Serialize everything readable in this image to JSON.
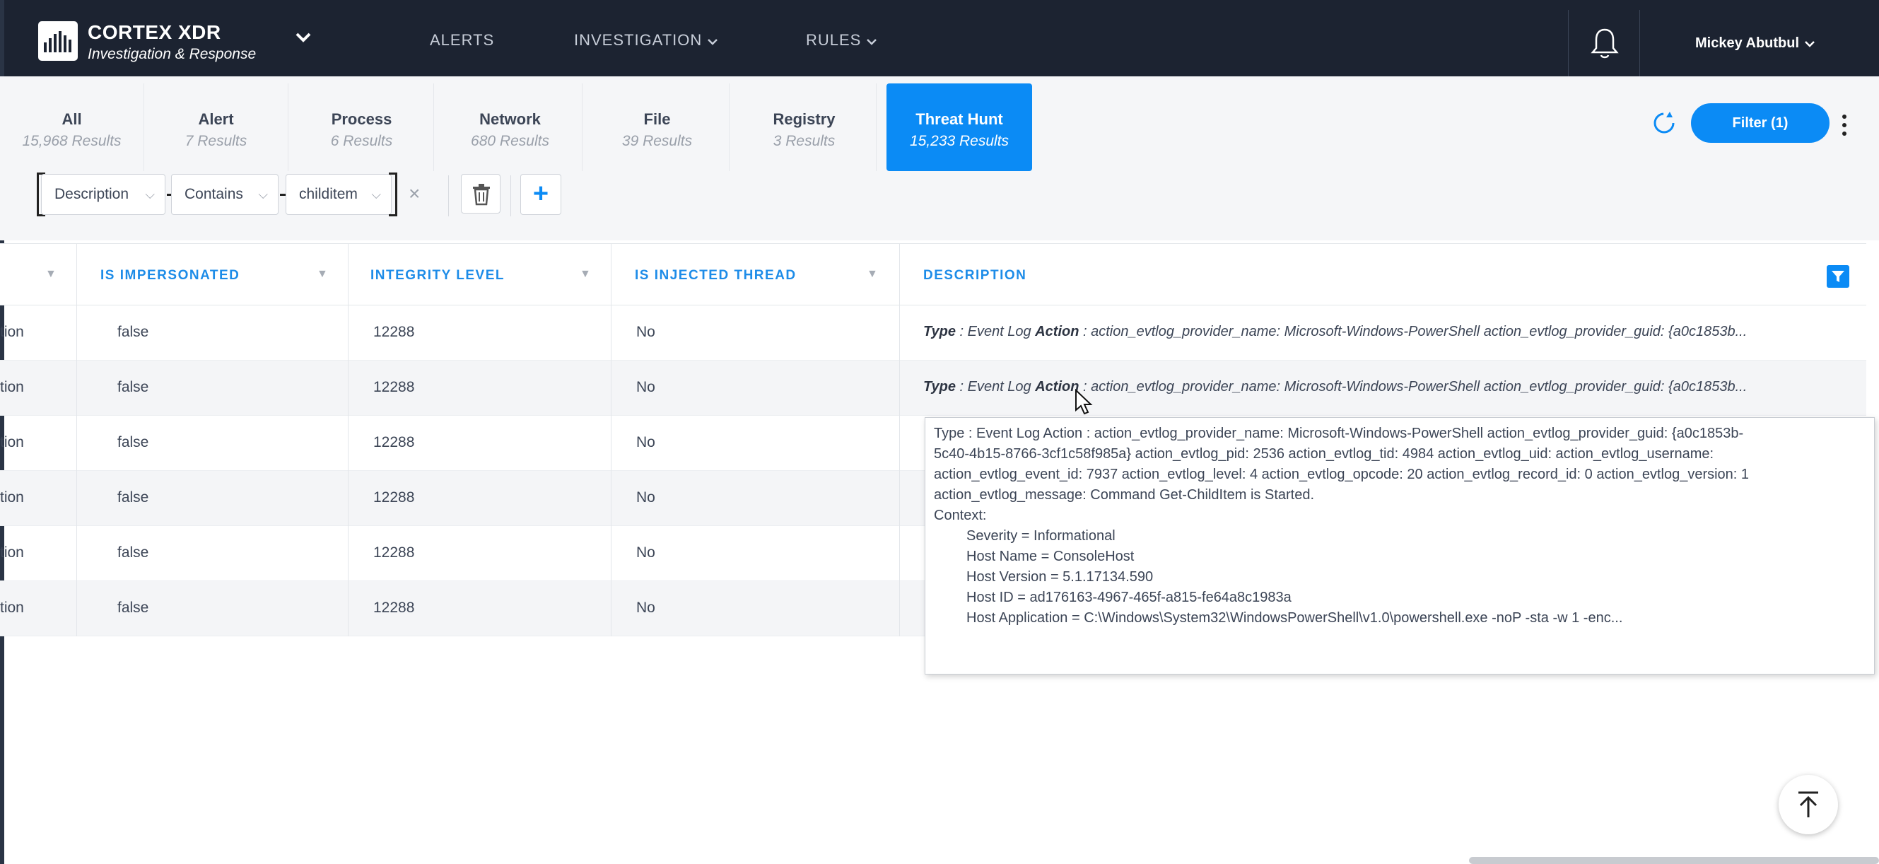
{
  "header": {
    "brand_title": "CORTEX XDR",
    "brand_subtitle": "Investigation & Response",
    "nav": [
      {
        "label": "ALERTS"
      },
      {
        "label": "INVESTIGATION"
      },
      {
        "label": "RULES"
      }
    ],
    "user_name": "Mickey Abutbul"
  },
  "tabs": [
    {
      "label": "All",
      "count": "15,968 Results"
    },
    {
      "label": "Alert",
      "count": "7 Results"
    },
    {
      "label": "Process",
      "count": "6 Results"
    },
    {
      "label": "Network",
      "count": "680 Results"
    },
    {
      "label": "File",
      "count": "39 Results"
    },
    {
      "label": "Registry",
      "count": "3 Results"
    },
    {
      "label": "Threat Hunt",
      "count": "15,233 Results",
      "active": true
    }
  ],
  "toolbar": {
    "filter_label": "Filter (1)"
  },
  "filter": {
    "field": "Description",
    "operator": "Contains",
    "value": "childitem"
  },
  "table": {
    "columns": [
      "IS IMPERSONATED",
      "INTEGRITY LEVEL",
      "IS INJECTED THREAD",
      "DESCRIPTION"
    ],
    "rows": [
      {
        "prev": "tion",
        "impersonated": "false",
        "integrity": "12288",
        "injected": "No"
      },
      {
        "prev": "tion",
        "impersonated": "false",
        "integrity": "12288",
        "injected": "No"
      },
      {
        "prev": "tion",
        "impersonated": "false",
        "integrity": "12288",
        "injected": "No"
      },
      {
        "prev": "tion",
        "impersonated": "false",
        "integrity": "12288",
        "injected": "No"
      },
      {
        "prev": "tion",
        "impersonated": "false",
        "integrity": "12288",
        "injected": "No"
      },
      {
        "prev": "tion",
        "impersonated": "false",
        "integrity": "12288",
        "injected": "No"
      }
    ],
    "desc_type_label": "Type",
    "desc_type_value": " : Event Log ",
    "desc_action_label": "Action",
    "desc_rest": " : action_evtlog_provider_name: Microsoft-Windows-PowerShell action_evtlog_provider_guid: {a0c1853b..."
  },
  "tooltip": {
    "line1": "Type : Event Log Action : action_evtlog_provider_name: Microsoft-Windows-PowerShell action_evtlog_provider_guid: {a0c1853b-",
    "line2": "5c40-4b15-8766-3cf1c58f985a} action_evtlog_pid: 2536 action_evtlog_tid: 4984 action_evtlog_uid:  action_evtlog_username:",
    "line3": "action_evtlog_event_id: 7937 action_evtlog_level: 4 action_evtlog_opcode: 20 action_evtlog_record_id: 0 action_evtlog_version: 1",
    "line4": "action_evtlog_message: Command Get-ChildItem is Started.",
    "context_label": "Context:",
    "severity": "Severity = Informational",
    "host_name": "Host Name = ConsoleHost",
    "host_version": "Host Version = 5.1.17134.590",
    "host_id": "Host ID = ad176163-4967-465f-a815-fe64a8c1983a",
    "host_app": "Host Application = C:\\Windows\\System32\\WindowsPowerShell\\v1.0\\powershell.exe -noP -sta -w 1 -enc..."
  },
  "colors": {
    "accent": "#0b8bf5",
    "topbar": "#1c2331",
    "header_text": "#1d8ce8"
  },
  "icons": [
    "cortex-logo-icon",
    "chevron-down-icon",
    "bell-icon",
    "refresh-icon",
    "kebab-menu-icon",
    "trash-icon",
    "plus-icon",
    "close-icon",
    "filter-funnel-icon",
    "arrow-up-icon",
    "mouse-cursor-icon"
  ]
}
